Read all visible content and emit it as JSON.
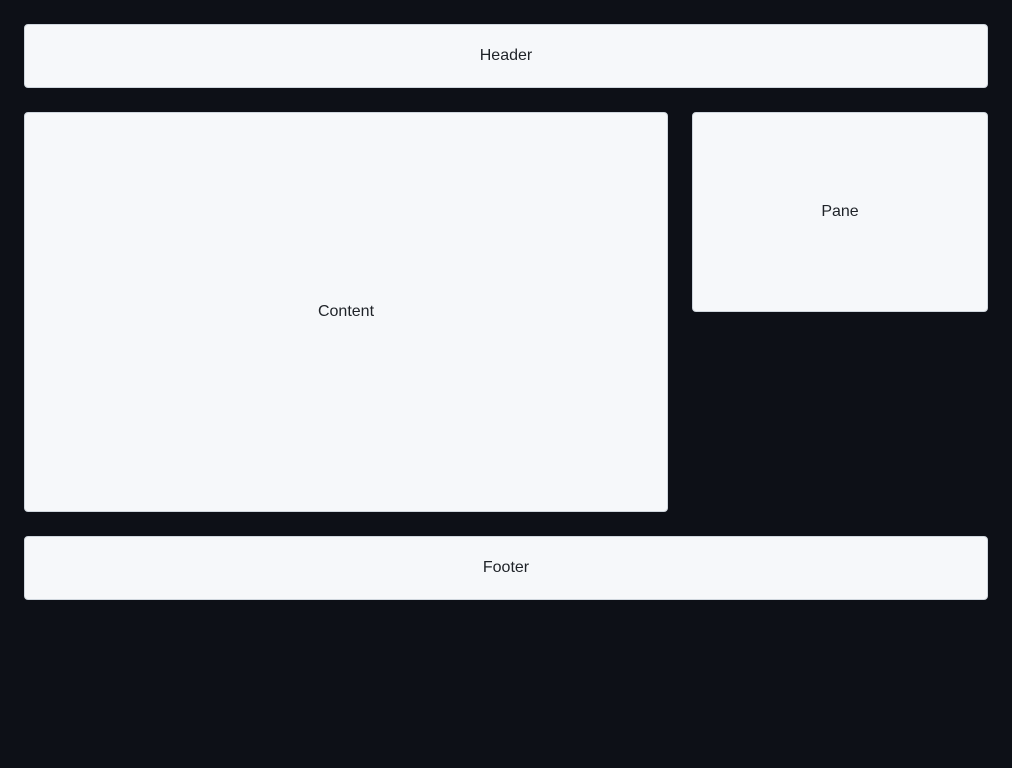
{
  "header": {
    "label": "Header"
  },
  "content": {
    "label": "Content"
  },
  "pane": {
    "label": "Pane"
  },
  "footer": {
    "label": "Footer"
  },
  "colors": {
    "background": "#0d1017",
    "panel": "#f6f8fa",
    "text": "#1f2328"
  }
}
